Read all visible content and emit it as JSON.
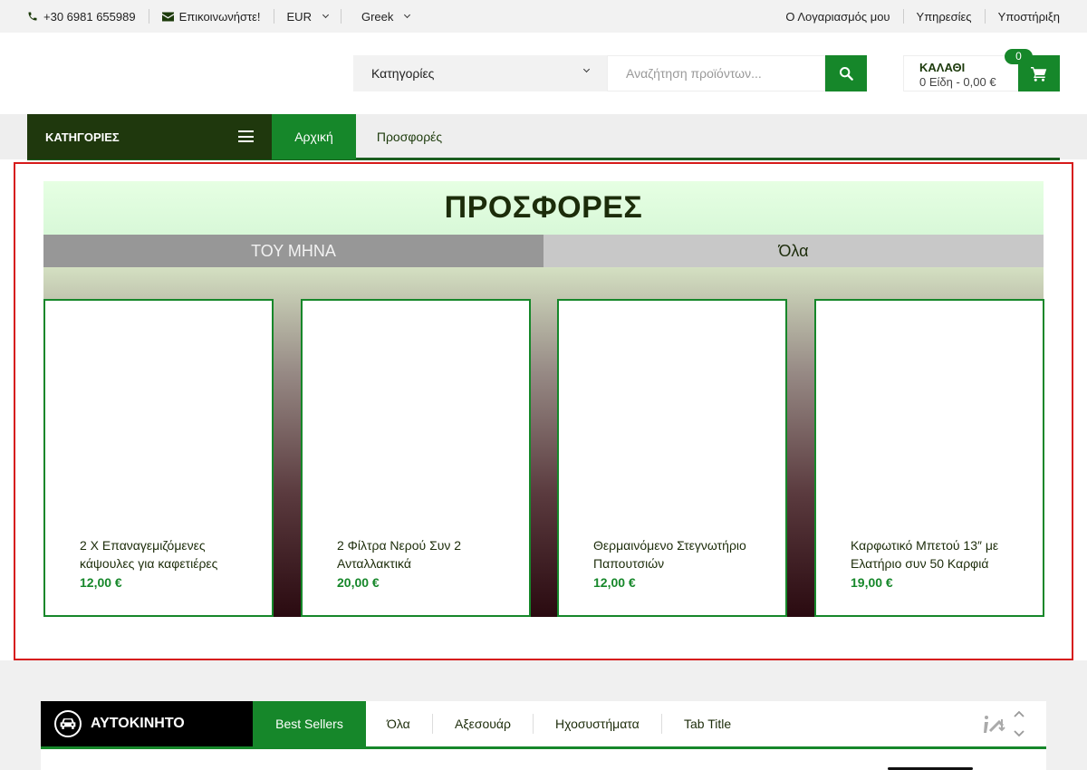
{
  "topbar": {
    "phone": "+30 6981 655989",
    "contact": "Επικοινωνήστε!",
    "currency": "EUR",
    "language": "Greek",
    "links": [
      "Ο Λογαριασμός μου",
      "Υπηρεσίες",
      "Υποστήριξη"
    ]
  },
  "header": {
    "category_select": "Κατηγορίες",
    "search_placeholder": "Αναζήτηση προϊόντων...",
    "cart_title": "ΚΑΛΑΘΙ",
    "cart_summary": "0 Είδη - 0,00 €",
    "cart_count": "0"
  },
  "nav": {
    "categories_label": "ΚΑΤΗΓΟΡΙΕΣ",
    "items": [
      "Αρχική",
      "Προσφορές"
    ]
  },
  "offers": {
    "title": "ΠΡΟΣΦΟΡΕΣ",
    "tabs": [
      "ΤΟΥ ΜΗΝΑ",
      "Όλα"
    ],
    "products": [
      {
        "name": "2 Χ Επαναγεμιζόμενες κάψουλες για καφετιέρες",
        "price": "12,00 €"
      },
      {
        "name": "2 Φίλτρα Νερού Συν 2 Ανταλλακτικά",
        "price": "20,00 €"
      },
      {
        "name": "Θερμαινόμενο Στεγνωτήριο Παπουτσιών",
        "price": "12,00 €"
      },
      {
        "name": "Καρφωτικό Μπετού 13″ με Ελατήριο συν 50 Καρφιά",
        "price": "19,00 €"
      }
    ]
  },
  "car_section": {
    "label": "ΑΥΤΟΚΙΝΗΤΟ",
    "tabs": [
      "Best Sellers",
      "Όλα",
      "Αξεσουάρ",
      "Ηχοσυστήματα",
      "Tab Title"
    ]
  },
  "colors": {
    "brand_green": "#16872a",
    "dark_green": "#1f380d",
    "highlight_border": "#d61a1a"
  }
}
